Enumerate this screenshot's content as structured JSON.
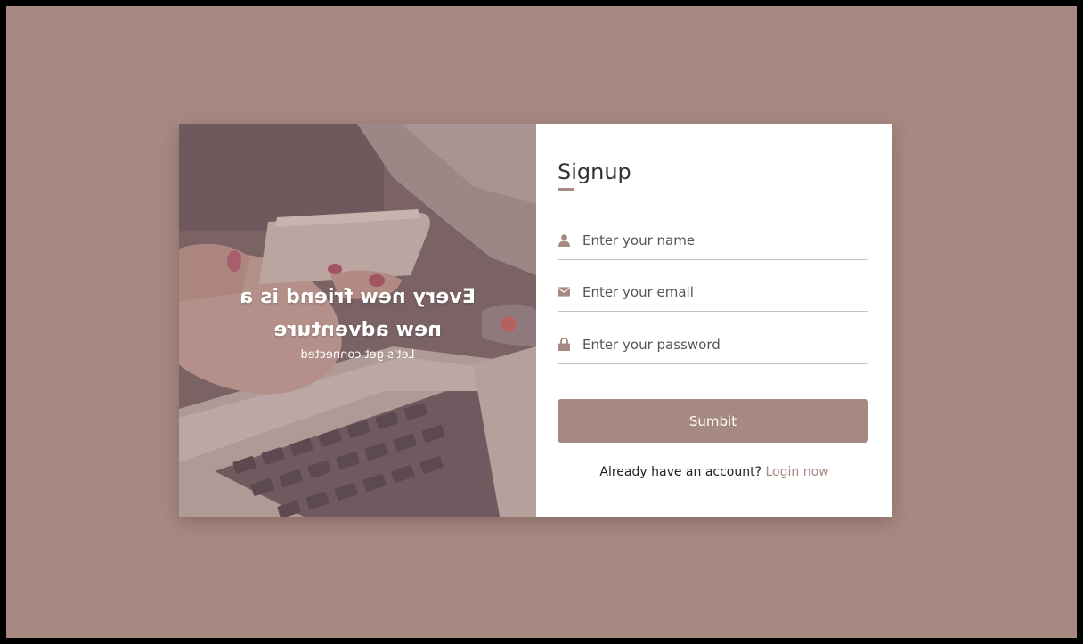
{
  "colors": {
    "background": "#a68a82",
    "accent": "#a68a82",
    "panel": "#ffffff"
  },
  "hero": {
    "headline_line1": "Every new friend is a",
    "headline_line2": "new adventure",
    "subline": "Let's get connected"
  },
  "form": {
    "title": "Signup",
    "fields": [
      {
        "icon": "user-icon",
        "placeholder": "Enter your name",
        "value": ""
      },
      {
        "icon": "envelope-icon",
        "placeholder": "Enter your email",
        "value": ""
      },
      {
        "icon": "lock-icon",
        "placeholder": "Enter your password",
        "value": ""
      }
    ],
    "submit_label": "Sumbit",
    "switch_text": "Already have an account?",
    "switch_link": "Login now"
  }
}
